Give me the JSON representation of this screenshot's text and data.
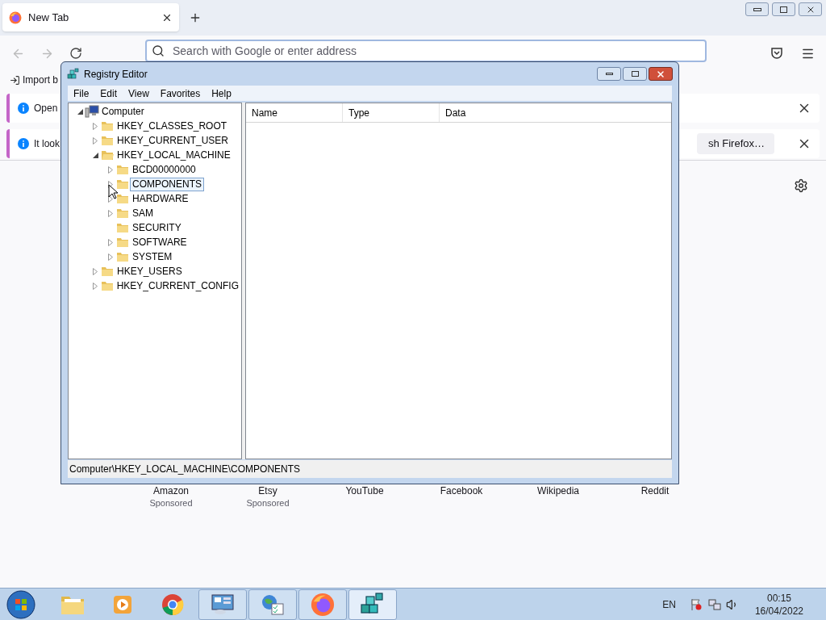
{
  "browser": {
    "tab": {
      "title": "New Tab"
    },
    "address_bar": {
      "placeholder": "Search with Google or enter address"
    },
    "import_link": "Import b",
    "notifications": [
      {
        "message": "Open"
      },
      {
        "message": "It look",
        "button": "sh Firefox…"
      }
    ],
    "shortcuts": [
      {
        "label": "Amazon",
        "sponsor": "Sponsored"
      },
      {
        "label": "Etsy",
        "sponsor": "Sponsored"
      },
      {
        "label": "YouTube"
      },
      {
        "label": "Facebook"
      },
      {
        "label": "Wikipedia"
      },
      {
        "label": "Reddit"
      }
    ]
  },
  "registry_editor": {
    "title": "Registry Editor",
    "menu": [
      "File",
      "Edit",
      "View",
      "Favorites",
      "Help"
    ],
    "tree": [
      {
        "label": "Computer",
        "has_children": true,
        "expanded": true,
        "selected": false,
        "children": [
          {
            "label": "HKEY_CLASSES_ROOT",
            "has_children": true,
            "expanded": false,
            "selected": false
          },
          {
            "label": "HKEY_CURRENT_USER",
            "has_children": true,
            "expanded": false,
            "selected": false
          },
          {
            "label": "HKEY_LOCAL_MACHINE",
            "has_children": true,
            "expanded": true,
            "selected": false,
            "children": [
              {
                "label": "BCD00000000",
                "has_children": true,
                "expanded": false,
                "selected": false
              },
              {
                "label": "COMPONENTS",
                "has_children": true,
                "expanded": false,
                "selected": true
              },
              {
                "label": "HARDWARE",
                "has_children": true,
                "expanded": false,
                "selected": false
              },
              {
                "label": "SAM",
                "has_children": true,
                "expanded": false,
                "selected": false
              },
              {
                "label": "SECURITY",
                "has_children": false,
                "expanded": false,
                "selected": false
              },
              {
                "label": "SOFTWARE",
                "has_children": true,
                "expanded": false,
                "selected": false
              },
              {
                "label": "SYSTEM",
                "has_children": true,
                "expanded": false,
                "selected": false
              }
            ]
          },
          {
            "label": "HKEY_USERS",
            "has_children": true,
            "expanded": false,
            "selected": false
          },
          {
            "label": "HKEY_CURRENT_CONFIG",
            "has_children": true,
            "expanded": false,
            "selected": false
          }
        ]
      }
    ],
    "columns": [
      "Name",
      "Type",
      "Data"
    ],
    "status_bar": "Computer\\HKEY_LOCAL_MACHINE\\COMPONENTS"
  },
  "taskbar": {
    "buttons": [
      {
        "running": false,
        "selected": false
      },
      {
        "running": false,
        "selected": false
      },
      {
        "running": false,
        "selected": false
      },
      {
        "running": true,
        "selected": false
      },
      {
        "running": true,
        "selected": false
      },
      {
        "running": true,
        "selected": false
      },
      {
        "running": true,
        "selected": true
      }
    ],
    "language": "EN",
    "time": "00:15",
    "date": "16/04/2022"
  }
}
